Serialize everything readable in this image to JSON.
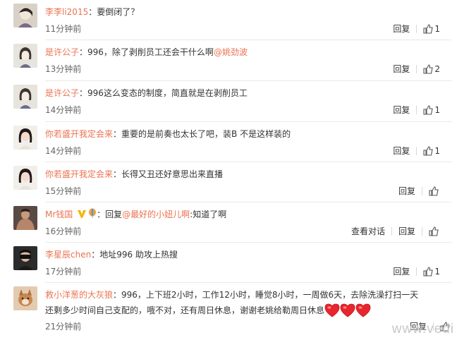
{
  "colors": {
    "username": "#eb7350",
    "text": "#333333",
    "time": "#666666",
    "divider": "#e9e9e9"
  },
  "icons": {
    "like": "thumbs-up-icon",
    "heart": "red-heart-icon",
    "badge_v": "gold-v-badge-icon",
    "badge_balloon": "balloon-badge-icon"
  },
  "comments": [
    {
      "user": "李李li2015",
      "colon": "：",
      "text": "要倒闭了？",
      "time": "11分钟前",
      "reply": "回复",
      "likes": "1"
    },
    {
      "user": "是许公子",
      "colon": "：",
      "text": "996，除了剥削员工还会干什么啊",
      "mention": "@姚劲波",
      "time": "13分钟前",
      "reply": "回复",
      "likes": "2"
    },
    {
      "user": "是许公子",
      "colon": "：",
      "text": "996这么变态的制度，简直就是在剥削员工",
      "time": "14分钟前",
      "reply": "回复",
      "likes": "1"
    },
    {
      "user": "你若盛开我定会来",
      "colon": "：",
      "text": "重要的是前奏也太长了吧，装B  不是这样装的",
      "time": "14分钟前",
      "reply": "回复",
      "likes": "1"
    },
    {
      "user": "你若盛开我定会来",
      "colon": "：",
      "text": "长得又丑还好意思出来直播",
      "time": "15分钟前",
      "reply": "回复",
      "likes": ""
    },
    {
      "user": "Mr钱国",
      "colon": "：",
      "text_prefix": "回复",
      "mention": "@最好的小妞儿啊",
      "text": ":知道了啊",
      "time": "16分钟前",
      "view_conv": "查看对话",
      "reply": "回复",
      "likes": ""
    },
    {
      "user": "李星辰chen",
      "colon": "：",
      "text": "地址996 助攻上热搜",
      "time": "17分钟前",
      "reply": "回复",
      "likes": "1"
    },
    {
      "user": "救小洋葱的大灰狼",
      "colon": "：",
      "text": "996，上下班2小时，工作12小时，睡觉8小时，一周做6天，去除洗澡打扫一天",
      "text2": "还剩多少时间自己支配的，哦不对，还有周日休息，谢谢老姚给勒周日休息",
      "time": "21分钟前",
      "reply": "回复",
      "likes": ""
    }
  ],
  "watermark": "www.vedi"
}
